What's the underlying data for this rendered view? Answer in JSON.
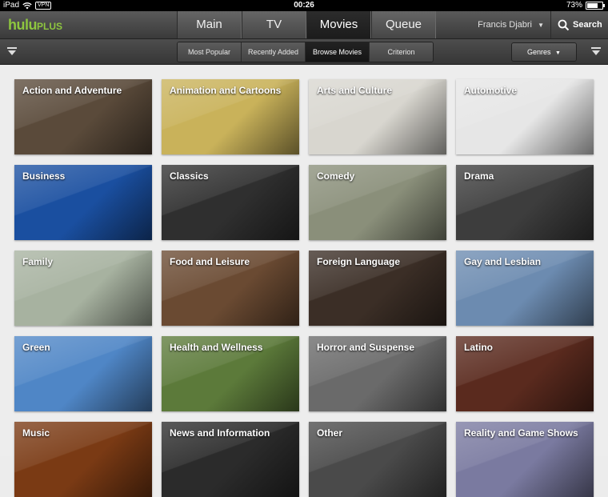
{
  "status_bar": {
    "device": "iPad",
    "vpn": "VPN",
    "time": "00:26",
    "battery": "73%"
  },
  "header": {
    "logo_main": "hulu",
    "logo_plus": "PLUS",
    "tabs": [
      {
        "label": "Main"
      },
      {
        "label": "TV"
      },
      {
        "label": "Movies"
      },
      {
        "label": "Queue"
      }
    ],
    "active_tab": "Movies",
    "user_name": "Francis Djabri",
    "search_label": "Search"
  },
  "subnav": {
    "tabs": [
      {
        "label": "Most Popular"
      },
      {
        "label": "Recently Added"
      },
      {
        "label": "Browse Movies"
      },
      {
        "label": "Criterion"
      }
    ],
    "active_tab": "Browse Movies",
    "genres_label": "Genres"
  },
  "genres": [
    {
      "label": "Action and Adventure",
      "color": "#5a4a3a"
    },
    {
      "label": "Animation and Cartoons",
      "color": "#c9b25a"
    },
    {
      "label": "Arts and Culture",
      "color": "#d8d6cf"
    },
    {
      "label": "Automotive",
      "color": "#e6e6e6"
    },
    {
      "label": "Business",
      "color": "#1a4fa0"
    },
    {
      "label": "Classics",
      "color": "#2f2f2f"
    },
    {
      "label": "Comedy",
      "color": "#8a8f7a"
    },
    {
      "label": "Drama",
      "color": "#3d3d3d"
    },
    {
      "label": "Family",
      "color": "#a7b2a0"
    },
    {
      "label": "Food and Leisure",
      "color": "#6a4a32"
    },
    {
      "label": "Foreign Language",
      "color": "#3b2e26"
    },
    {
      "label": "Gay and Lesbian",
      "color": "#6c8bb0"
    },
    {
      "label": "Green",
      "color": "#4f86c6"
    },
    {
      "label": "Health and Wellness",
      "color": "#5c7a3a"
    },
    {
      "label": "Horror and Suspense",
      "color": "#6a6a6a"
    },
    {
      "label": "Latino",
      "color": "#5a2a1e"
    },
    {
      "label": "Music",
      "color": "#7a3a14"
    },
    {
      "label": "News and Information",
      "color": "#2b2b2b"
    },
    {
      "label": "Other",
      "color": "#4a4a4a"
    },
    {
      "label": "Reality and Game Shows",
      "color": "#7a7aa0"
    }
  ]
}
